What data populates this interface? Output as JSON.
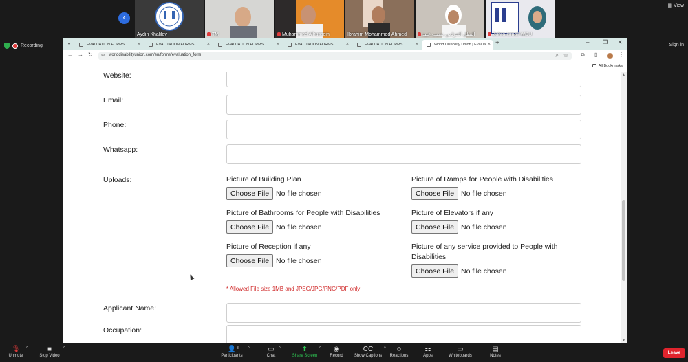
{
  "gallery": {
    "view_label": "View",
    "participants": [
      {
        "name": "Aydin Khalilov",
        "bg": "#3a3a3a"
      },
      {
        "name": "TM",
        "bg": "#d8d8d8"
      },
      {
        "name": "Muhammad Alhussein",
        "bg": "#e58b2a"
      },
      {
        "name": "Ibrahim Mohammed Ahmed",
        "bg": "#8a6f5a"
      },
      {
        "name": "البطل الحولمي نصيب عبيد",
        "bg": "#c9c3bb"
      },
      {
        "name": "Zuhra Ismail WDU",
        "bg": "#e9e9ee"
      }
    ]
  },
  "meeting_status": {
    "recording_label": "Recording",
    "sign_in_label": "Sign in"
  },
  "browser": {
    "tabs": [
      {
        "label": "EVALUATION FORMS"
      },
      {
        "label": "EVALUATION FORMS"
      },
      {
        "label": "EVALUATION FORMS"
      },
      {
        "label": "EVALUATION FORMS"
      },
      {
        "label": "EVALUATION FORMS"
      },
      {
        "label": "World Disability Union | Evalua"
      }
    ],
    "url": "worlddisabilityunion.com/en/forms/evaluation_form",
    "all_bookmarks_label": "All Bookmarks"
  },
  "form": {
    "website_label": "Website:",
    "email_label": "Email:",
    "phone_label": "Phone:",
    "whatsapp_label": "Whatsapp:",
    "uploads_label": "Uploads:",
    "uploads": [
      {
        "title": "Picture of Building Plan",
        "button": "Choose File",
        "status": "No file chosen"
      },
      {
        "title": "Picture of Ramps for People with Disabilities",
        "button": "Choose File",
        "status": "No file chosen"
      },
      {
        "title": "Picture of Bathrooms for People with Disabilities",
        "button": "Choose File",
        "status": "No file chosen"
      },
      {
        "title": "Picture of Elevators if any",
        "button": "Choose File",
        "status": "No file chosen"
      },
      {
        "title": "Picture of Reception if any",
        "button": "Choose File",
        "status": "No file chosen"
      },
      {
        "title": "Picture of any service provided to People with Disabilities",
        "button": "Choose File",
        "status": "No file chosen"
      }
    ],
    "file_note": "* Allowed File size 1MB and JPEG/JPG/PNG/PDF only",
    "applicant_name_label": "Applicant Name:",
    "occupation_label": "Occupation:"
  },
  "meeting_toolbar": {
    "unmute": "Unmute",
    "stop_video": "Stop Video",
    "participants": "Participants",
    "participant_count": "8",
    "chat": "Chat",
    "share_screen": "Share Screen",
    "record": "Record",
    "show_captions": "Show Captions",
    "reactions": "Reactions",
    "apps": "Apps",
    "whiteboards": "Whiteboards",
    "notes": "Notes",
    "leave": "Leave"
  }
}
